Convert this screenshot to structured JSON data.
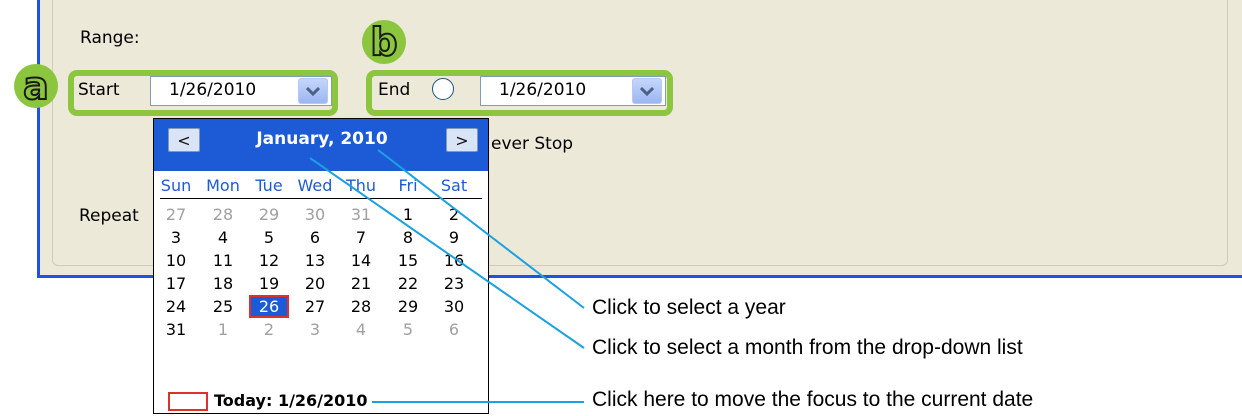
{
  "range_label": "Range:",
  "start": {
    "label": "Start",
    "value": "1/26/2010"
  },
  "end": {
    "label": "End",
    "value": "1/26/2010"
  },
  "never_stop_label": "ever Stop",
  "repeat_label": "Repeat",
  "badges": {
    "a": "a",
    "b": "b"
  },
  "calendar": {
    "title": "January, 2010",
    "prev": "<",
    "next": ">",
    "weekdays": [
      "Sun",
      "Mon",
      "Tue",
      "Wed",
      "Thu",
      "Fri",
      "Sat"
    ],
    "weeks": [
      [
        "27",
        "28",
        "29",
        "30",
        "31",
        "1",
        "2"
      ],
      [
        "3",
        "4",
        "5",
        "6",
        "7",
        "8",
        "9"
      ],
      [
        "10",
        "11",
        "12",
        "13",
        "14",
        "15",
        "16"
      ],
      [
        "17",
        "18",
        "19",
        "20",
        "21",
        "22",
        "23"
      ],
      [
        "24",
        "25",
        "26",
        "27",
        "28",
        "29",
        "30"
      ],
      [
        "31",
        "1",
        "2",
        "3",
        "4",
        "5",
        "6"
      ]
    ],
    "selected_day": "26",
    "today_label": "Today: 1/26/2010"
  },
  "annotations": {
    "year": "Click to select a year",
    "month": "Click to select a month from the drop-down list",
    "today": "Click here to move the focus to the current date"
  },
  "colors": {
    "accent_green": "#8CC63E",
    "calendar_blue": "#1D5BD6",
    "callout_line": "#1BA0E1",
    "today_red": "#E0302C"
  }
}
